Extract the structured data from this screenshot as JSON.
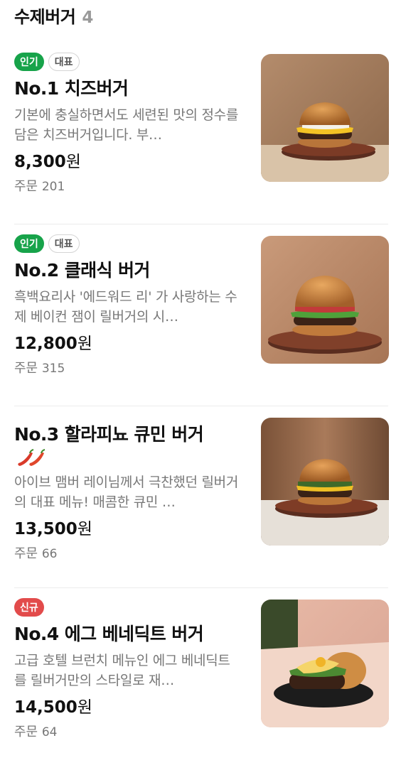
{
  "section": {
    "title": "수제버거",
    "count": "4"
  },
  "items": [
    {
      "badges": [
        {
          "text": "인기",
          "kind": "popular"
        },
        {
          "text": "대표",
          "kind": "rep"
        }
      ],
      "name": "No.1 치즈버거",
      "desc": "기본에 충실하면서도 세련된 맛의 정수를 담은 치즈버거입니다. 부…",
      "price": "8,300",
      "currency": "원",
      "order_label": "주문",
      "orders": "201",
      "image_icon": "cheeseburger-photo"
    },
    {
      "badges": [
        {
          "text": "인기",
          "kind": "popular"
        },
        {
          "text": "대표",
          "kind": "rep"
        }
      ],
      "name": "No.2 클래식 버거",
      "desc": "흑백요리사 '에드워드 리' 가 사랑하는 수제 베이컨 잼이 릴버거의 시…",
      "price": "12,800",
      "currency": "원",
      "order_label": "주문",
      "orders": "315",
      "image_icon": "classic-burger-photo"
    },
    {
      "badges": [],
      "name": "No.3 할라피뇨 큐민 버거",
      "spicy_icon": "chili-pepper-icon",
      "desc": "아이브 맴버 레이님께서 극찬했던 릴버거의 대표 메뉴! 매콤한 큐민 …",
      "price": "13,500",
      "currency": "원",
      "order_label": "주문",
      "orders": "66",
      "image_icon": "jalapeno-burger-photo"
    },
    {
      "badges": [
        {
          "text": "신규",
          "kind": "new"
        }
      ],
      "name": "No.4 에그 베네딕트 버거",
      "desc": "고급 호텔 브런치 메뉴인 에그 베네딕트를 릴버거만의 스타일로 재…",
      "price": "14,500",
      "currency": "원",
      "order_label": "주문",
      "orders": "64",
      "image_icon": "egg-benedict-burger-photo"
    }
  ],
  "colors": {
    "popular": "#17a34a",
    "new": "#e24b4b",
    "muted": "#777777"
  }
}
